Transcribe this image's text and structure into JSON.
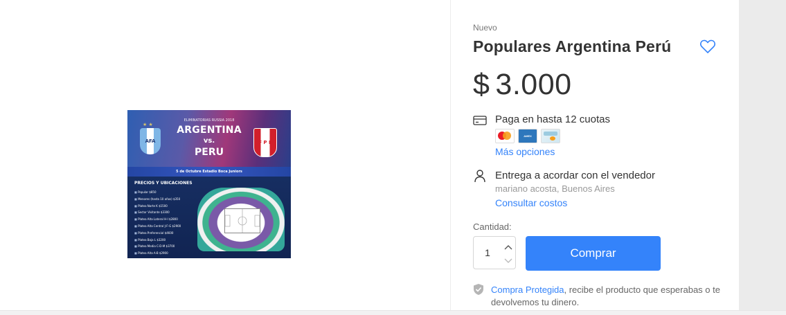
{
  "product_image": {
    "elim": "ELIMINATORIAS RUSSIA 2018",
    "team_home": "ARGENTINA",
    "vs": "vs.",
    "team_away": "PERU",
    "home_crest_text": "AFA",
    "away_crest_text": "F P F",
    "date_line": "5 de Octubre Estadio Boca Juniors",
    "prices_title": "PRECIOS Y UBICACIONES",
    "price_list": [
      "Popular  $850",
      "Menores (hasta 10 años)  $350",
      "Platea Norte K  $1500",
      "Sector Visitante  $3300",
      "Platea Alta Lateral H-I  $2800",
      "Platea Alta Central J-F-G  $2900",
      "Platea Preferencial  $4600",
      "Platea Baja L  $3200",
      "Platea Media C-D-M  $3700",
      "Platea Alta A-B  $2900"
    ]
  },
  "product": {
    "condition": "Nuevo",
    "title": "Populares Argentina Perú",
    "favorite_icon": "heart-outline-icon",
    "price_currency": "$",
    "price_amount": "3.000"
  },
  "payment": {
    "icon": "credit-card-icon",
    "text": "Paga en hasta 12 cuotas",
    "methods": [
      "Mastercard",
      "American Express",
      "Mercado Pago"
    ],
    "more_link": "Más opciones"
  },
  "shipping": {
    "icon": "person-icon",
    "text": "Entrega a acordar con el vendedor",
    "location": "mariano acosta, Buenos Aires",
    "costs_link": "Consultar costos"
  },
  "purchase": {
    "quantity_label": "Cantidad:",
    "quantity_value": "1",
    "buy_label": "Comprar"
  },
  "protection": {
    "link": "Compra Protegida",
    "text": ", recibe el producto que esperabas o te devolvemos tu dinero."
  },
  "colors": {
    "accent": "#3483fa",
    "text": "#333333",
    "muted": "#999999"
  }
}
